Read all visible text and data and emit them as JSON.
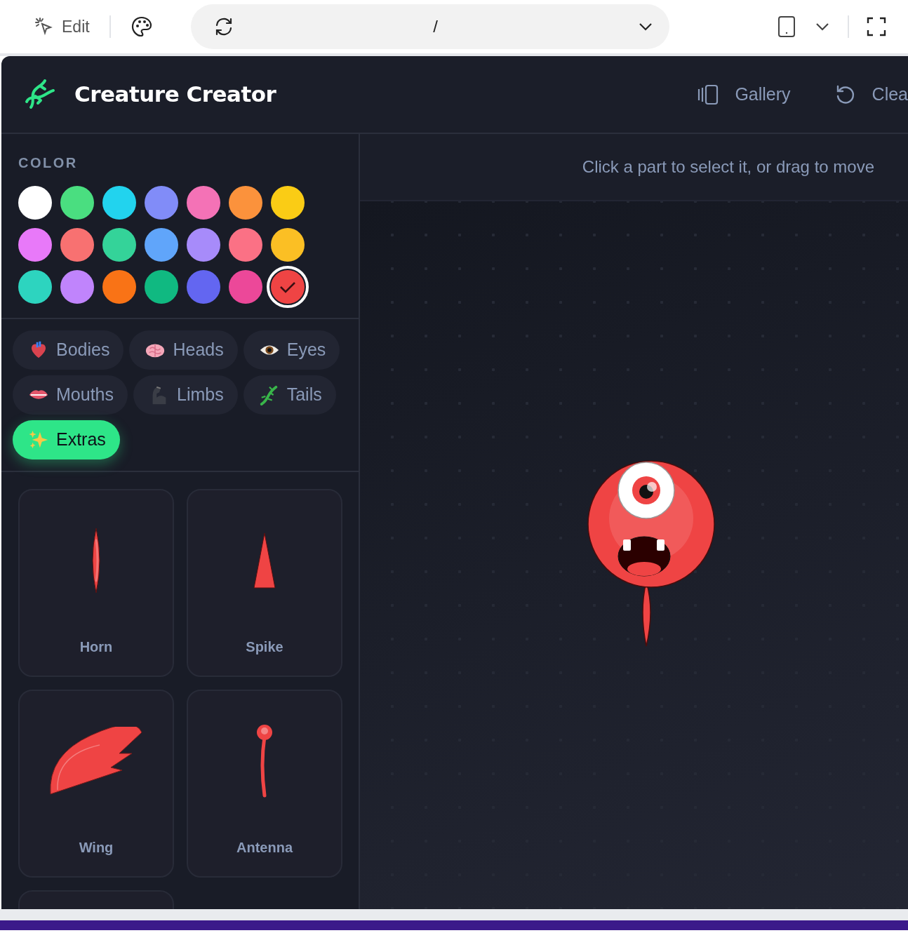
{
  "toolbar": {
    "edit_label": "Edit",
    "url": "/"
  },
  "app": {
    "title": "Creature Creator",
    "actions": [
      {
        "label": "Gallery"
      },
      {
        "label": "Clea"
      }
    ]
  },
  "color_section": {
    "label": "COLOR",
    "swatches": [
      {
        "color": "#ffffff",
        "selected": false
      },
      {
        "color": "#4ade80",
        "selected": false
      },
      {
        "color": "#22d3ee",
        "selected": false
      },
      {
        "color": "#818cf8",
        "selected": false
      },
      {
        "color": "#f472b6",
        "selected": false
      },
      {
        "color": "#fb923c",
        "selected": false
      },
      {
        "color": "#facc15",
        "selected": false
      },
      {
        "color": "#e879f9",
        "selected": false
      },
      {
        "color": "#f87171",
        "selected": false
      },
      {
        "color": "#34d399",
        "selected": false
      },
      {
        "color": "#60a5fa",
        "selected": false
      },
      {
        "color": "#a78bfa",
        "selected": false
      },
      {
        "color": "#fb7185",
        "selected": false
      },
      {
        "color": "#fbbf24",
        "selected": false
      },
      {
        "color": "#2dd4bf",
        "selected": false
      },
      {
        "color": "#c084fc",
        "selected": false
      },
      {
        "color": "#f97316",
        "selected": false
      },
      {
        "color": "#10b981",
        "selected": false
      },
      {
        "color": "#6366f1",
        "selected": false
      },
      {
        "color": "#ec4899",
        "selected": false
      },
      {
        "color": "#ef4444",
        "selected": true
      }
    ]
  },
  "categories": [
    {
      "label": "Bodies",
      "selected": false
    },
    {
      "label": "Heads",
      "selected": false
    },
    {
      "label": "Eyes",
      "selected": false
    },
    {
      "label": "Mouths",
      "selected": false
    },
    {
      "label": "Limbs",
      "selected": false
    },
    {
      "label": "Tails",
      "selected": false
    },
    {
      "label": "Extras",
      "selected": true
    }
  ],
  "parts": [
    {
      "kind": "horn",
      "label": "Horn"
    },
    {
      "kind": "spike",
      "label": "Spike"
    },
    {
      "kind": "wing",
      "label": "Wing"
    },
    {
      "kind": "antenna",
      "label": "Antenna"
    },
    {
      "kind": "cut_off"
    }
  ],
  "canvas": {
    "hint": "Click a part to select it, or drag to move"
  }
}
